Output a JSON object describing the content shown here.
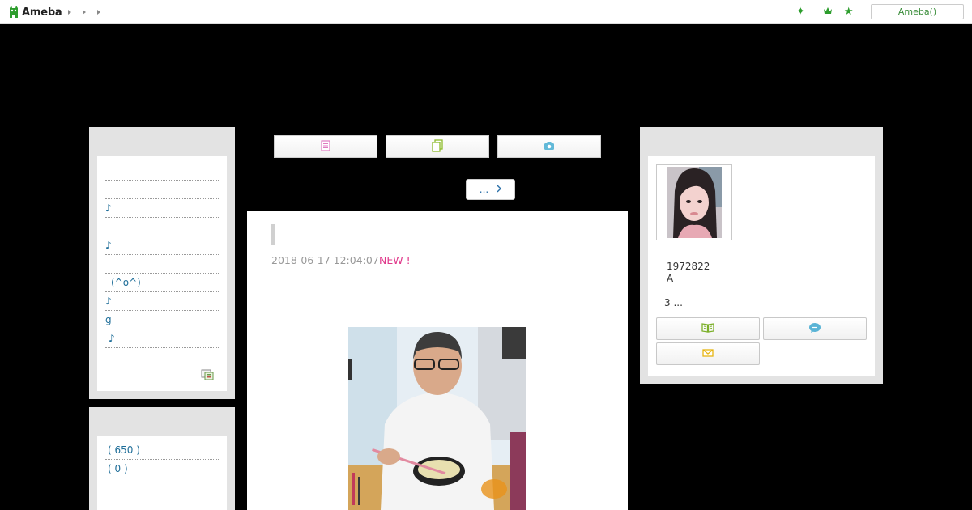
{
  "topbar": {
    "logo_text": "Ameba",
    "ameba_button": "Ameba()"
  },
  "left_sidebar": {
    "menu_items": [
      "",
      "",
      "♪",
      "",
      "♪",
      "",
      "(^o^)",
      "♪",
      "g",
      "♪"
    ],
    "counts": [
      "( 650 )",
      "( 0 )"
    ]
  },
  "nav": {
    "more_label": "..."
  },
  "article": {
    "date": "2018-06-17 12:04:07",
    "new_badge": "NEW !"
  },
  "profile": {
    "id_text": "1972822",
    "sub_text": "A",
    "more_text": "3 ..."
  },
  "colors": {
    "accent_green": "#2d9d2d",
    "link_blue": "#1f6e99",
    "new_pink": "#e0378a"
  }
}
